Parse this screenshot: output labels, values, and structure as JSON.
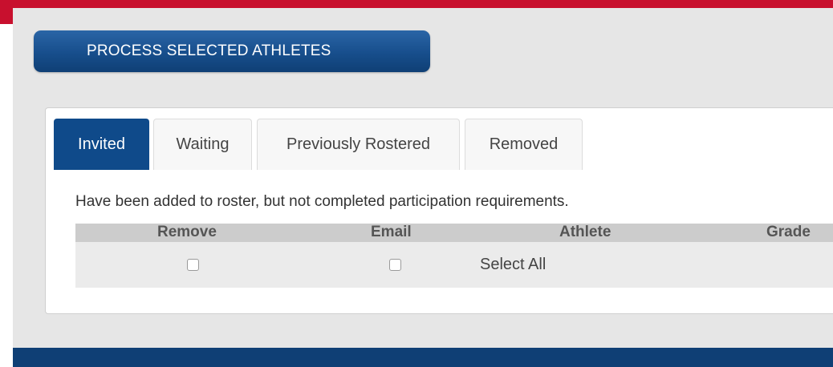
{
  "actions": {
    "process_label": "PROCESS SELECTED ATHLETES"
  },
  "tabs": [
    {
      "label": "Invited",
      "active": true
    },
    {
      "label": "Waiting",
      "active": false
    },
    {
      "label": "Previously Rostered",
      "active": false
    },
    {
      "label": "Removed",
      "active": false
    }
  ],
  "invited": {
    "description": "Have been added to roster, but not completed participation requirements.",
    "columns": [
      "Remove",
      "Email",
      "Athlete",
      "Grade"
    ],
    "select_all_label": "Select All"
  },
  "colors": {
    "accent_red": "#c8102e",
    "primary_blue": "#0f4a8a",
    "button_blue": "#174e8c",
    "panel_gray": "#e6e6e6"
  }
}
